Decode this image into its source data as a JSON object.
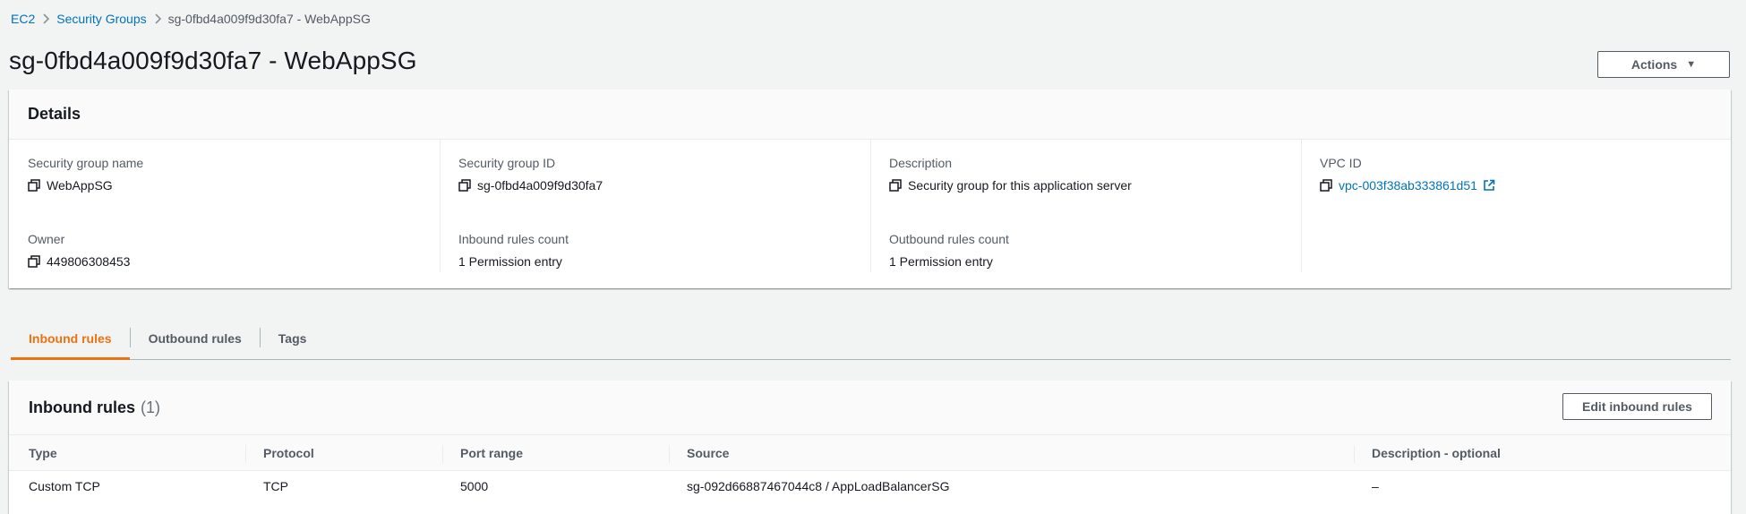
{
  "breadcrumb": {
    "items": [
      "EC2",
      "Security Groups"
    ],
    "current": "sg-0fbd4a009f9d30fa7 - WebAppSG"
  },
  "page": {
    "title": "sg-0fbd4a009f9d30fa7 - WebAppSG",
    "actions_label": "Actions"
  },
  "details": {
    "heading": "Details",
    "sg_name_label": "Security group name",
    "sg_name_value": "WebAppSG",
    "sg_id_label": "Security group ID",
    "sg_id_value": "sg-0fbd4a009f9d30fa7",
    "description_label": "Description",
    "description_value": "Security group for this application server",
    "vpc_label": "VPC ID",
    "vpc_value": "vpc-003f38ab333861d51",
    "owner_label": "Owner",
    "owner_value": "449806308453",
    "inbound_count_label": "Inbound rules count",
    "inbound_count_value": "1 Permission entry",
    "outbound_count_label": "Outbound rules count",
    "outbound_count_value": "1 Permission entry"
  },
  "tabs": [
    {
      "label": "Inbound rules",
      "active": true
    },
    {
      "label": "Outbound rules",
      "active": false
    },
    {
      "label": "Tags",
      "active": false
    }
  ],
  "inbound": {
    "title": "Inbound rules",
    "count": "(1)",
    "edit_label": "Edit inbound rules",
    "columns": [
      "Type",
      "Protocol",
      "Port range",
      "Source",
      "Description - optional"
    ],
    "rows": [
      [
        "Custom TCP",
        "TCP",
        "5000",
        "sg-092d66887467044c8 / AppLoadBalancerSG",
        "–"
      ]
    ]
  },
  "colors": {
    "link": "#0073bb",
    "tab_active": "#ec7211",
    "background": "#f2f3f3"
  }
}
